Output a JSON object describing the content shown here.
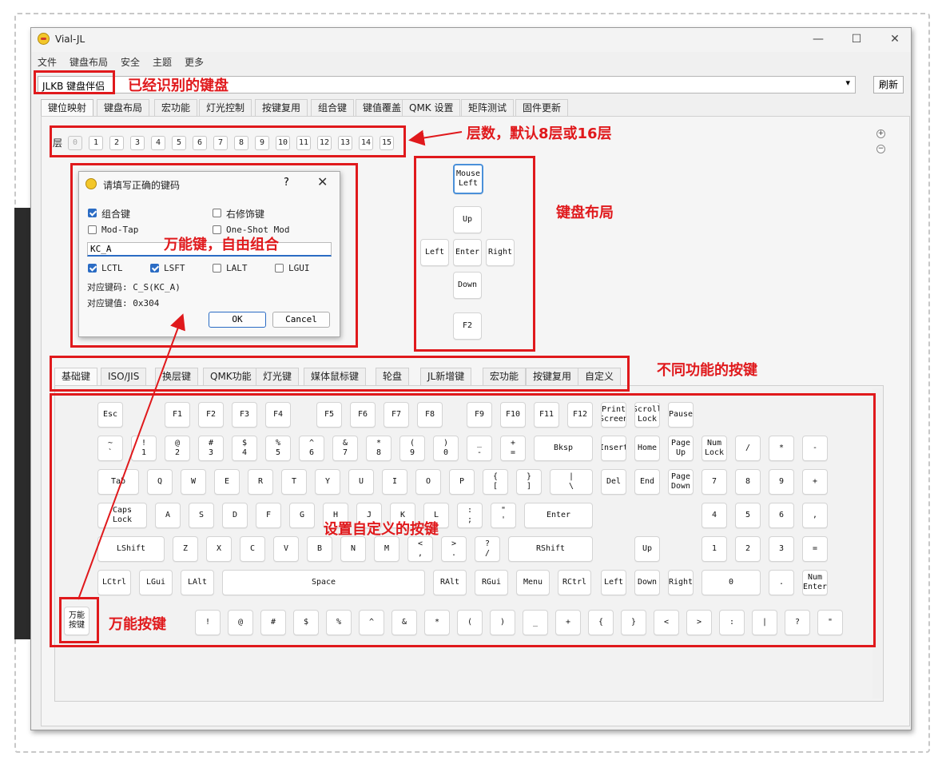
{
  "window": {
    "title": "Vial-JL",
    "minimize": "—",
    "maximize": "☐",
    "close": "✕"
  },
  "menu": [
    "文件",
    "键盘布局",
    "安全",
    "主题",
    "更多"
  ],
  "device": {
    "selected": "JLKB 键盘伴侣",
    "arrow": "▾",
    "refresh_label": "刷新"
  },
  "main_tabs": [
    "键位映射",
    "键盘布局",
    "宏功能",
    "灯光控制",
    "按键复用",
    "组合键",
    "键值覆盖",
    "QMK 设置",
    "矩阵测试",
    "固件更新"
  ],
  "layers": {
    "label": "层",
    "items": [
      "0",
      "1",
      "2",
      "3",
      "4",
      "5",
      "6",
      "7",
      "8",
      "9",
      "10",
      "11",
      "12",
      "13",
      "14",
      "15"
    ],
    "plus": "+",
    "minus": "−"
  },
  "layout_keys": [
    "Mouse\nLeft",
    "Up",
    "Left",
    "Enter",
    "Right",
    "Down",
    "F2"
  ],
  "dialog": {
    "title": "请填写正确的键码",
    "help": "?",
    "close": "✕",
    "combo_label": "组合键",
    "right_mod_label": "右修饰键",
    "mod_tap_label": "Mod-Tap",
    "one_shot_label": "One-Shot Mod",
    "keycode_value": "KC_A",
    "mods": [
      "LCTL",
      "LSFT",
      "LALT",
      "LGUI"
    ],
    "code_line": "对应键码: C_S(KC_A)",
    "value_line": "对应键值: 0x304",
    "ok_label": "OK",
    "cancel_label": "Cancel"
  },
  "bottom_tabs": [
    "基础键",
    "ISO/JIS",
    "换层键",
    "QMK功能",
    "灯光键",
    "媒体鼠标键",
    "轮盘",
    "JL新增键",
    "宏功能",
    "按键复用",
    "自定义"
  ],
  "keyboard": {
    "row1": [
      "Esc",
      "F1",
      "F2",
      "F3",
      "F4",
      "F5",
      "F6",
      "F7",
      "F8",
      "F9",
      "F10",
      "F11",
      "F12",
      "Print\nScreen",
      "Scroll\nLock",
      "Pause"
    ],
    "row2": [
      "~\n`",
      "!\n1",
      "@\n2",
      "#\n3",
      "$\n4",
      "%\n5",
      "^\n6",
      "&\n7",
      "*\n8",
      "(\n9",
      ")\n0",
      "_\n-",
      "+\n=",
      "Bksp",
      "Insert",
      "Home",
      "Page\nUp",
      "Num\nLock",
      "/",
      "*",
      "-"
    ],
    "row3": [
      "Tab",
      "Q",
      "W",
      "E",
      "R",
      "T",
      "Y",
      "U",
      "I",
      "O",
      "P",
      "{\n[",
      "}\n]",
      "|\n\\",
      "Del",
      "End",
      "Page\nDown",
      "7",
      "8",
      "9",
      "+"
    ],
    "row4": [
      "Caps\nLock",
      "A",
      "S",
      "D",
      "F",
      "G",
      "H",
      "J",
      "K",
      "L",
      ":\n;",
      "\"\n'",
      "Enter",
      "4",
      "5",
      "6",
      ","
    ],
    "row5": [
      "LShift",
      "Z",
      "X",
      "C",
      "V",
      "B",
      "N",
      "M",
      "<\n,",
      ">\n.",
      "?\n/",
      "RShift",
      "Up",
      "1",
      "2",
      "3",
      "="
    ],
    "row6": [
      "LCtrl",
      "LGui",
      "LAlt",
      "Space",
      "RAlt",
      "RGui",
      "Menu",
      "RCtrl",
      "Left",
      "Down",
      "Right",
      "0",
      ".",
      "Num\nEnter"
    ],
    "row7": [
      "万能\n按键",
      "!",
      "@",
      "#",
      "$",
      "%",
      "^",
      "&",
      "*",
      "(",
      ")",
      "_",
      "+",
      "{",
      "}",
      "<",
      ">",
      ":",
      "|",
      "?",
      "\""
    ]
  },
  "annotations": {
    "detected_keyboard": "已经识别的键盘",
    "layers_note": "层数，默认8层或16层",
    "layout_note": "键盘布局",
    "any_key_note": "万能键，自由组合",
    "function_keys_note": "不同功能的按键",
    "custom_keys_note": "设置自定义的按键",
    "any_key_button_note": "万能按键"
  },
  "colors": {
    "annotation_red": "#e0191c",
    "accent_blue": "#2b6cc4"
  }
}
